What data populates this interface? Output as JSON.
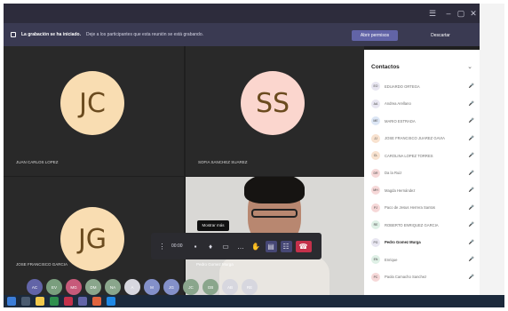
{
  "banner": {
    "title": "La grabación se ha iniciado.",
    "text": "Deje a los participantes que esta reunión se está grabando.",
    "open_button": "Abrir permisos",
    "dismiss_button": "Descartar"
  },
  "tiles": [
    {
      "initials": "JC",
      "name": "JUAN CARLOS LOPEZ"
    },
    {
      "initials": "SS",
      "name": "SOFIA SANCHEZ SUAREZ"
    },
    {
      "initials": "JG",
      "name": "JOSE FRANCISCO GARCIA"
    }
  ],
  "video": {
    "name": "Pedro Gomez Murga"
  },
  "controls": {
    "timer": "00:00",
    "tooltip": "Mostrar más"
  },
  "panel": {
    "title": "Contactos",
    "items": [
      {
        "name": "EDUARDO ORTEGA",
        "initials": "EO",
        "color": "#e8e6f1"
      },
      {
        "name": "Andrea Arellano",
        "initials": "AA",
        "color": "#e8e6f1"
      },
      {
        "name": "MARIO ESTRADA",
        "initials": "ME",
        "color": "#dce6f5"
      },
      {
        "name": "JOSE FRANCISCO JUAREZ GAVIA",
        "initials": "JJ",
        "color": "#f8e2cf"
      },
      {
        "name": "CAROLINA LOPEZ TORRES",
        "initials": "CL",
        "color": "#f8e2cf"
      },
      {
        "name": "Da la Ruiz",
        "initials": "DR",
        "color": "#f6d8d8"
      },
      {
        "name": "Magda Hernández",
        "initials": "MH",
        "color": "#f6d8d8"
      },
      {
        "name": "Paco de Jesus Herrera Santos",
        "initials": "PJ",
        "color": "#f6d8d8"
      },
      {
        "name": "ROBERTO ENRIQUEZ GARCIA",
        "initials": "RE",
        "color": "#dff0e6"
      },
      {
        "name": "Pedro Gomez Murga",
        "initials": "PG",
        "color": "#e8e6f1"
      },
      {
        "name": "Enrique",
        "initials": "EN",
        "color": "#dff0e6"
      },
      {
        "name": "Paola Camacho Sanchez",
        "initials": "PC",
        "color": "#f6d8d8"
      }
    ]
  },
  "bubbles": [
    {
      "label": "AC",
      "color": "#6264a7"
    },
    {
      "label": "EV",
      "color": "#7a9e7e"
    },
    {
      "label": "MG",
      "color": "#c75a7a"
    },
    {
      "label": "DM",
      "color": "#8aa68c"
    },
    {
      "label": "NA",
      "color": "#8aa68c"
    },
    {
      "label": "A",
      "color": "#d7d7df"
    },
    {
      "label": "M",
      "color": "#8390c9"
    },
    {
      "label": "JG",
      "color": "#8390c9"
    },
    {
      "label": "JC",
      "color": "#8aa68c"
    },
    {
      "label": "GB",
      "color": "#8aa68c"
    },
    {
      "label": "AB",
      "color": "#d7d7df"
    },
    {
      "label": "RE",
      "color": "#d7d7df"
    }
  ]
}
